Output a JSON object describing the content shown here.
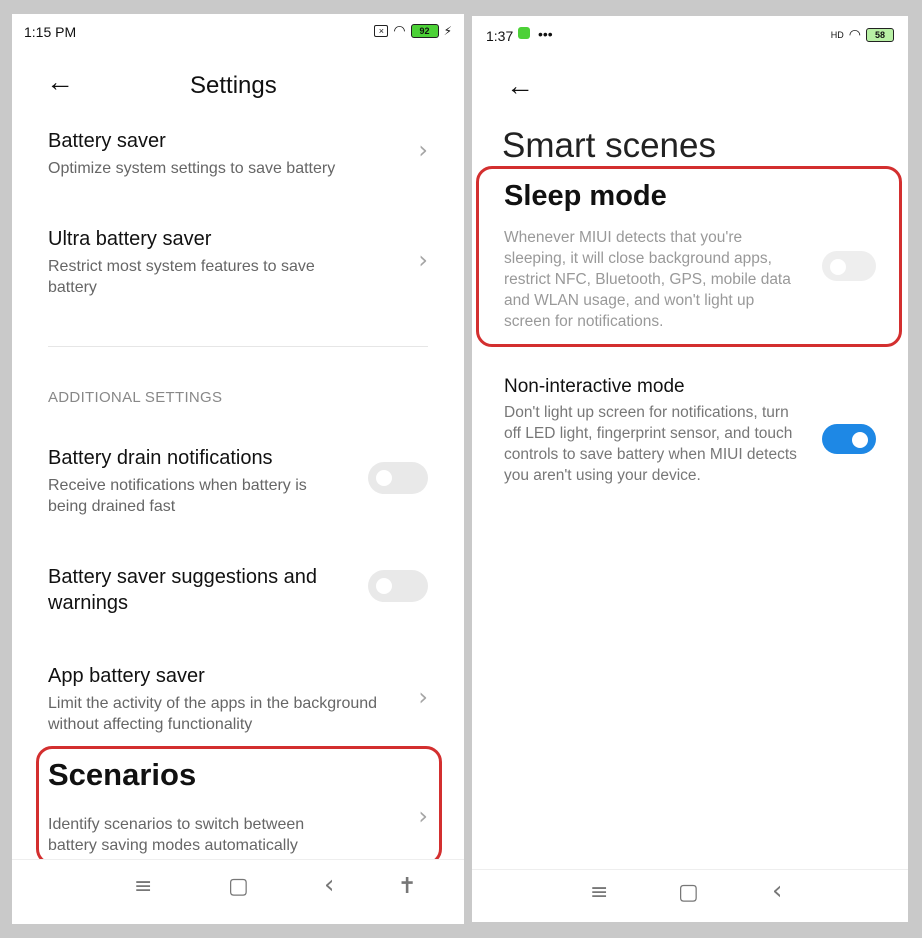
{
  "left": {
    "status": {
      "time": "1:15 PM",
      "battery": "92"
    },
    "header": {
      "title": "Settings"
    },
    "items": [
      {
        "title": "Battery saver",
        "subtitle": "Optimize system settings to save battery"
      },
      {
        "title": "Ultra battery saver",
        "subtitle": "Restrict most system features to save battery"
      }
    ],
    "section_label": "ADDITIONAL SETTINGS",
    "toggles": [
      {
        "title": "Battery drain notifications",
        "subtitle": "Receive notifications when battery is being drained fast",
        "on": false
      },
      {
        "title": "Battery saver suggestions and warnings",
        "on": false
      }
    ],
    "app_saver": {
      "title": "App battery saver",
      "subtitle": "Limit the activity of the apps in the background without affecting functionality"
    },
    "scenarios": {
      "title": "Scenarios",
      "subtitle": "Identify scenarios to switch between battery saving modes automatically"
    }
  },
  "right": {
    "status": {
      "time": "1:37",
      "dots": "•••",
      "battery": "58",
      "network": "HD"
    },
    "header": {
      "title": "Smart scenes"
    },
    "sleep": {
      "title": "Sleep mode",
      "subtitle": "Whenever MIUI detects that you're sleeping, it will close background apps, restrict NFC, Bluetooth, GPS, mobile data and WLAN usage, and won't light up screen for notifications.",
      "on": false
    },
    "noninteractive": {
      "title": "Non-interactive mode",
      "subtitle": "Don't light up screen for notifications, turn off LED light, fingerprint sensor, and touch controls to save battery when MIUI detects you aren't using your device.",
      "on": true
    }
  },
  "colors": {
    "accent": "#1e88e5",
    "highlight": "#d32f2f"
  },
  "icons": {
    "back": "←",
    "chevron": "›",
    "menu": "≡",
    "home": "▢",
    "nav_back": "‹",
    "accessibility": "✝"
  }
}
